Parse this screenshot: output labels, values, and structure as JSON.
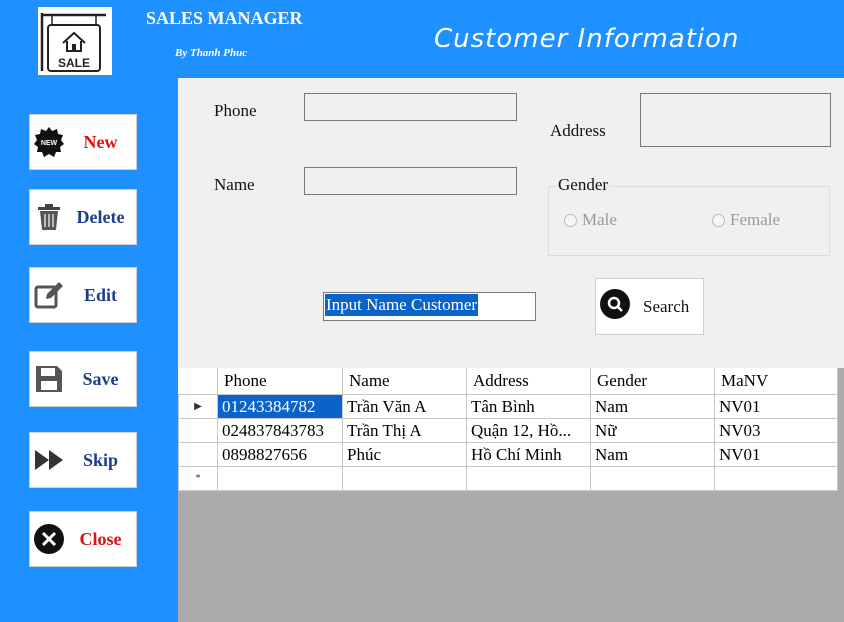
{
  "header": {
    "app_title": "SALES MANAGER",
    "app_subtitle": "By Thanh Phuc",
    "page_title": "Customer Information",
    "logo_text": "SALE"
  },
  "sidebar": {
    "new_label": "New",
    "delete_label": "Delete",
    "edit_label": "Edit",
    "save_label": "Save",
    "skip_label": "Skip",
    "close_label": "Close"
  },
  "form": {
    "phone_label": "Phone",
    "name_label": "Name",
    "address_label": "Address",
    "gender_label": "Gender",
    "male_label": "Male",
    "female_label": "Female",
    "phone_value": "",
    "name_value": "",
    "address_value": ""
  },
  "search": {
    "input_value": "Input Name Customer",
    "button_label": "Search"
  },
  "grid": {
    "columns": [
      "Phone",
      "Name",
      "Address",
      "Gender",
      "MaNV"
    ],
    "rows": [
      [
        "01243384782",
        "Trần Văn A",
        "Tân Bình",
        "Nam",
        "NV01"
      ],
      [
        "024837843783",
        "Trần Thị A",
        "Quận 12, Hồ...",
        "Nữ",
        "NV03"
      ],
      [
        "0898827656",
        "Phúc",
        "Hồ Chí Minh",
        "Nam",
        "NV01"
      ]
    ]
  },
  "colors": {
    "accent": "#1e90ff",
    "selection": "#0a63c9",
    "danger_text": "#e01010",
    "button_text": "#1d3c8a"
  }
}
